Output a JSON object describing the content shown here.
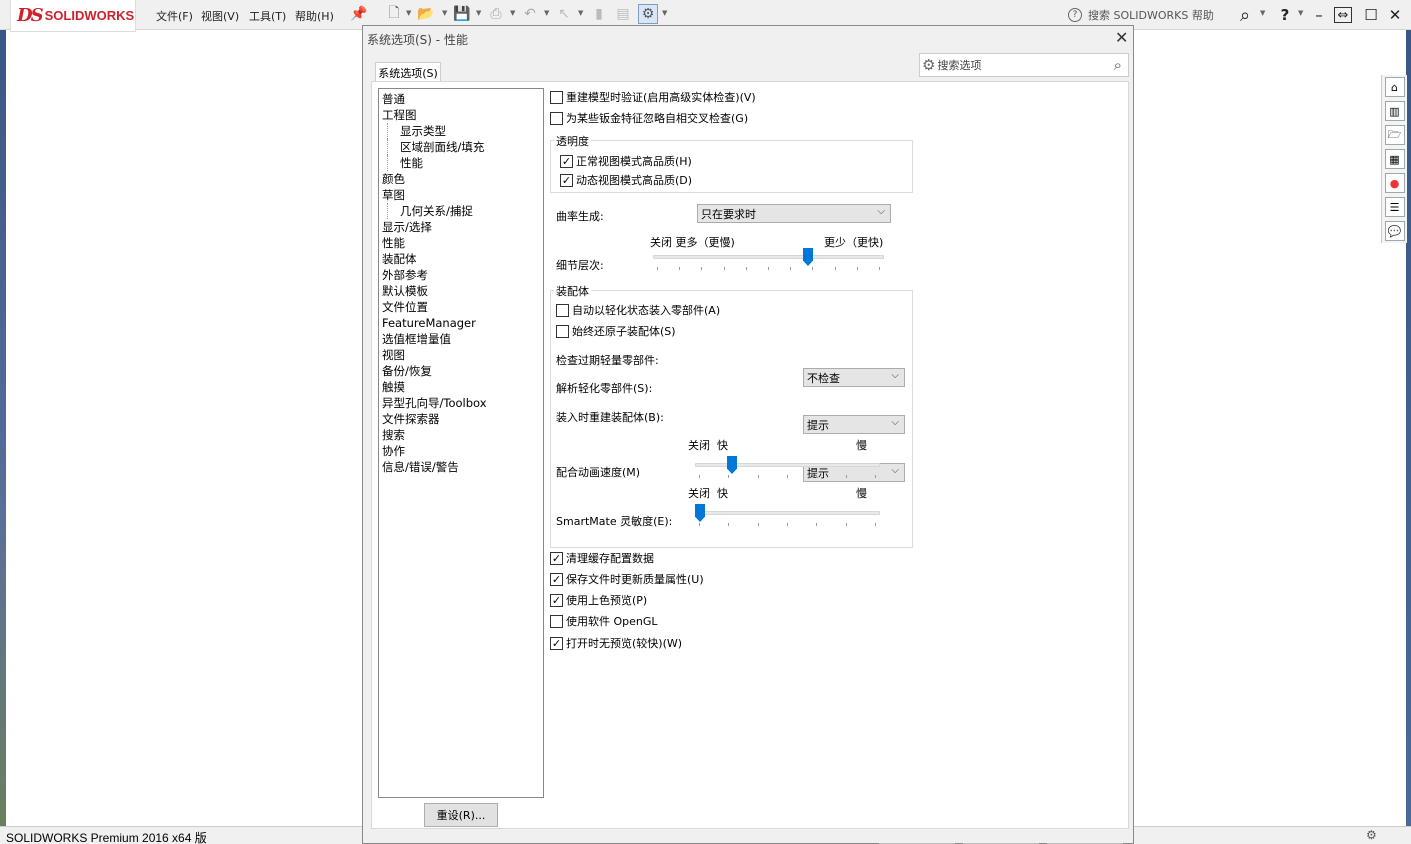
{
  "app": {
    "brand": "SOLIDWORKS",
    "status_bar": "SOLIDWORKS Premium 2016 x64 版",
    "menu": [
      "文件(F)",
      "视图(V)",
      "工具(T)",
      "帮助(H)"
    ],
    "help_search_placeholder": "搜索 SOLIDWORKS 帮助",
    "help_label": "?"
  },
  "dialog": {
    "title": "系统选项(S) - 性能",
    "tab_label": "系统选项(S)",
    "search_placeholder": "搜索选项",
    "reset_label": "重设(R)...",
    "tree": [
      {
        "label": "普通",
        "level": 0
      },
      {
        "label": "工程图",
        "level": 0
      },
      {
        "label": "显示类型",
        "level": 1
      },
      {
        "label": "区域剖面线/填充",
        "level": 1
      },
      {
        "label": "性能",
        "level": 1
      },
      {
        "label": "颜色",
        "level": 0
      },
      {
        "label": "草图",
        "level": 0
      },
      {
        "label": "几何关系/捕捉",
        "level": 1
      },
      {
        "label": "显示/选择",
        "level": 0
      },
      {
        "label": "性能",
        "level": 0
      },
      {
        "label": "装配体",
        "level": 0
      },
      {
        "label": "外部参考",
        "level": 0
      },
      {
        "label": "默认模板",
        "level": 0
      },
      {
        "label": "文件位置",
        "level": 0
      },
      {
        "label": "FeatureManager",
        "level": 0
      },
      {
        "label": "选值框增量值",
        "level": 0
      },
      {
        "label": "视图",
        "level": 0
      },
      {
        "label": "备份/恢复",
        "level": 0
      },
      {
        "label": "触摸",
        "level": 0
      },
      {
        "label": "异型孔向导/Toolbox",
        "level": 0
      },
      {
        "label": "文件探索器",
        "level": 0
      },
      {
        "label": "搜索",
        "level": 0
      },
      {
        "label": "协作",
        "level": 0
      },
      {
        "label": "信息/错误/警告",
        "level": 0
      }
    ],
    "options": {
      "verify_rebuild": {
        "label": "重建模型时验证(启用高级实体检查)(V)",
        "checked": false
      },
      "ignore_self_intersect": {
        "label": "为某些钣金特征忽略自相交叉检查(G)",
        "checked": false
      },
      "transparency": {
        "title": "透明度",
        "normal_hq": {
          "label": "正常视图模式高品质(H)",
          "checked": true
        },
        "dynamic_hq": {
          "label": "动态视图模式高品质(D)",
          "checked": true
        }
      },
      "curvature": {
        "label": "曲率生成:",
        "value": "只在要求时"
      },
      "detail_level": {
        "label": "细节层次:",
        "left_label": "关闭 更多（更慢)",
        "right_label": "更少（更快)",
        "value": 0.68
      },
      "assembly": {
        "title": "装配体",
        "auto_lightweight": {
          "label": "自动以轻化状态装入零部件(A)",
          "checked": false
        },
        "always_resolve": {
          "label": "始终还原子装配体(S)",
          "checked": false
        },
        "check_outdated": {
          "label": "检查过期轻量零部件:",
          "value": "不检查"
        },
        "resolve_lightweight": {
          "label": "解析轻化零部件(S):",
          "value": "提示"
        },
        "rebuild_on_load": {
          "label": "装入时重建装配体(B):",
          "value": "提示"
        },
        "mate_anim": {
          "label": "配合动画速度(M)",
          "off": "关闭",
          "fast": "快",
          "slow": "慢",
          "value": 0.18
        },
        "smartmate": {
          "label": "SmartMate 灵敏度(E):",
          "off": "关闭",
          "fast": "快",
          "slow": "慢",
          "value": 0.0
        }
      },
      "purge_cache": {
        "label": "清理缓存配置数据",
        "checked": true
      },
      "update_mass": {
        "label": "保存文件时更新质量属性(U)",
        "checked": true
      },
      "shaded_preview": {
        "label": "使用上色预览(P)",
        "checked": true
      },
      "software_opengl": {
        "label": "使用软件 OpenGL",
        "checked": false
      },
      "no_preview": {
        "label": "打开时无预览(较快)(W)",
        "checked": true
      }
    }
  },
  "colors": {
    "accent": "#0078d7",
    "brand": "#d0202a"
  }
}
